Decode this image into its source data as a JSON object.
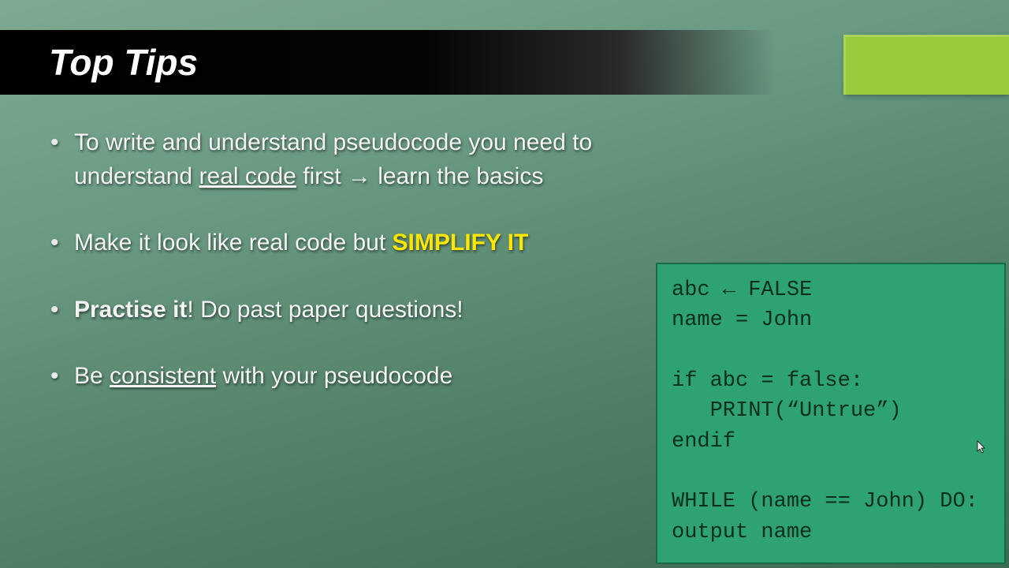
{
  "title": "Top Tips",
  "bullets": {
    "b1": {
      "pre": "To write and understand pseudocode you need to understand ",
      "real_code": "real code",
      "post1": " first ",
      "arrow": "→",
      "post2": " learn the basics"
    },
    "b2": {
      "pre": "Make it look like real code but ",
      "highlight": "SIMPLIFY IT"
    },
    "b3": {
      "bold": "Practise it",
      "rest": "! Do past paper questions!"
    },
    "b4": {
      "pre": "Be ",
      "consistent": "consistent",
      "post": " with your pseudocode"
    }
  },
  "code": "abc ← FALSE\nname = John\n\nif abc = false:\n   PRINT(“Untrue”)\nendif\n\nWHILE (name == John) DO:\noutput name"
}
